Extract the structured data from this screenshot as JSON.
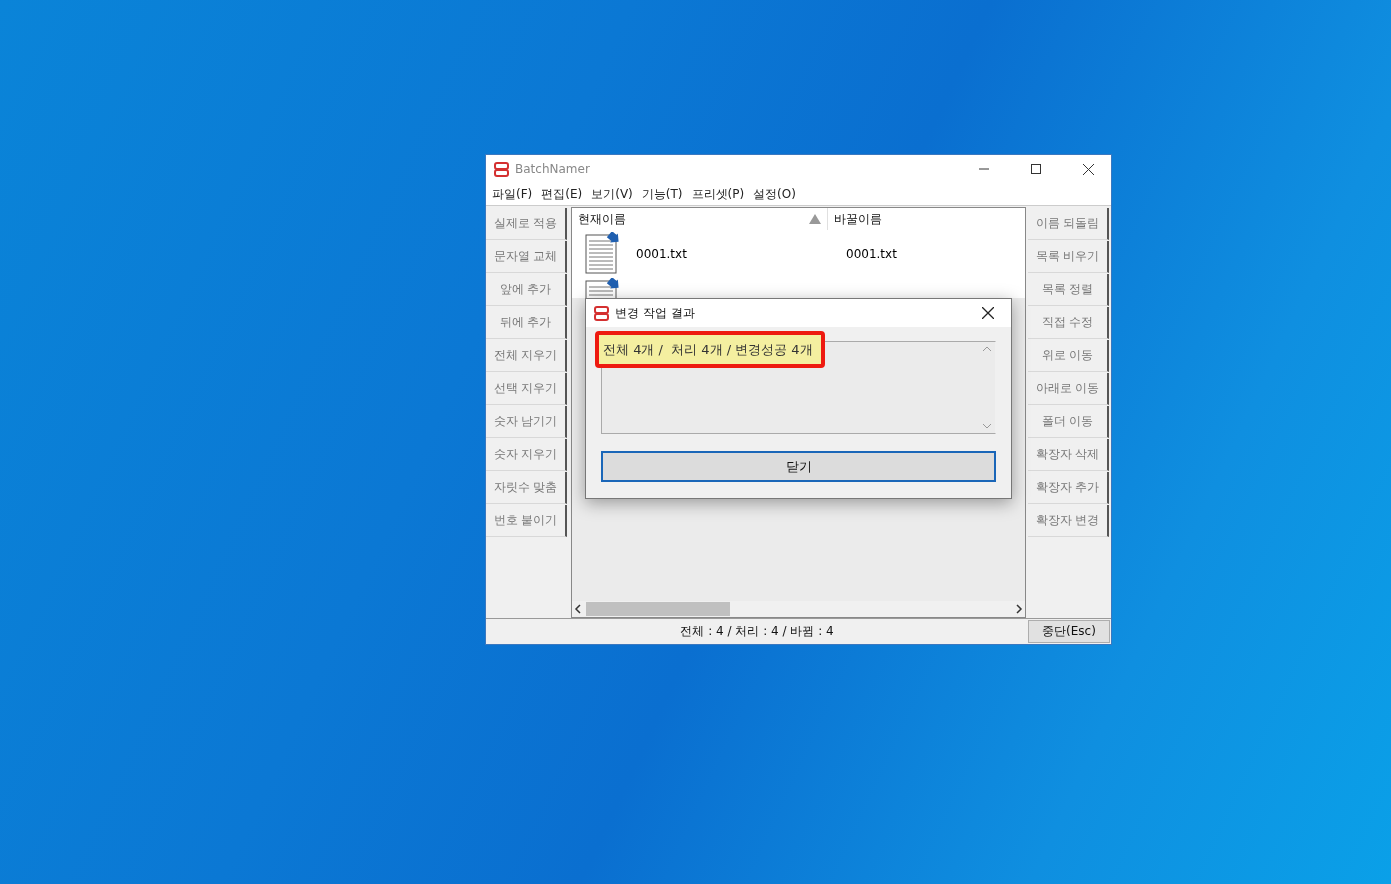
{
  "window": {
    "title": "BatchNamer"
  },
  "menu": [
    "파일(F)",
    "편집(E)",
    "보기(V)",
    "기능(T)",
    "프리셋(P)",
    "설정(O)"
  ],
  "left_buttons": [
    "실제로 적용",
    "문자열 교체",
    "앞에 추가",
    "뒤에 추가",
    "전체 지우기",
    "선택 지우기",
    "숫자 남기기",
    "숫자 지우기",
    "자릿수 맞춤",
    "번호 붙이기"
  ],
  "right_buttons": [
    "이름 되돌림",
    "목록 비우기",
    "목록 정렬",
    "직접 수정",
    "위로 이동",
    "아래로 이동",
    "폴더 이동",
    "확장자 삭제",
    "확장자 추가",
    "확장자 변경"
  ],
  "table": {
    "columns": [
      "현재이름",
      "바꿀이름"
    ],
    "rows": [
      {
        "current_name": "0001.txt",
        "new_name": "0001.txt"
      }
    ]
  },
  "status_bar": {
    "text": "전체 : 4 / 처리 : 4 / 바뀜 : 4",
    "stop_button": "중단(Esc)"
  },
  "dialog": {
    "title": "변경 작업 결과",
    "result": "전체 4개 /  처리 4개 / 변경성공 4개",
    "close_button": "닫기"
  }
}
